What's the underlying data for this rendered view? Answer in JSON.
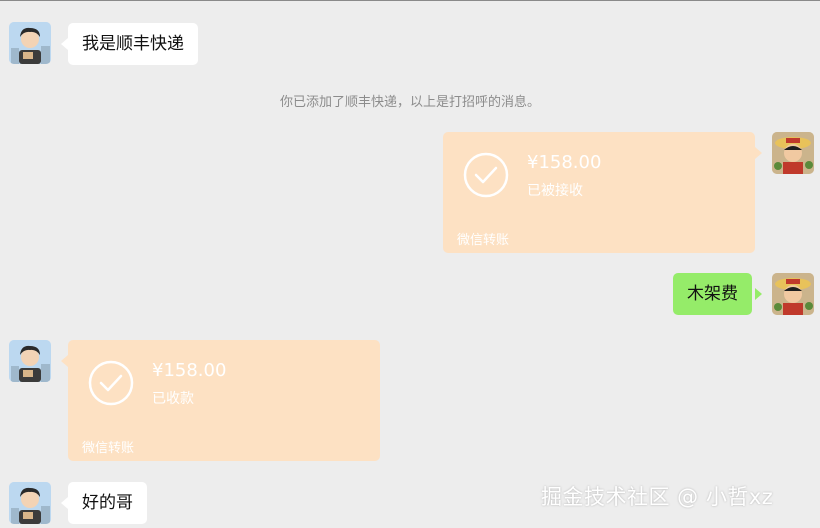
{
  "messages": {
    "m1": {
      "text": "我是顺丰快递"
    },
    "system_notice": "你已添加了顺丰快递，以上是打招呼的消息。",
    "t1": {
      "amount": "¥158.00",
      "status": "已被接收",
      "footer": "微信转账"
    },
    "m2": {
      "text": "木架费"
    },
    "t2": {
      "amount": "¥158.00",
      "status": "已收款",
      "footer": "微信转账"
    },
    "m3": {
      "text": "好的哥"
    }
  },
  "watermark": "掘金技术社区 @ 小哲xz",
  "colors": {
    "background": "#ededed",
    "incoming_bubble": "#ffffff",
    "outgoing_bubble": "#95ec69",
    "transfer_card": "#fde1c3"
  },
  "icons": [
    "contact-avatar",
    "self-avatar",
    "check-circle-icon"
  ]
}
